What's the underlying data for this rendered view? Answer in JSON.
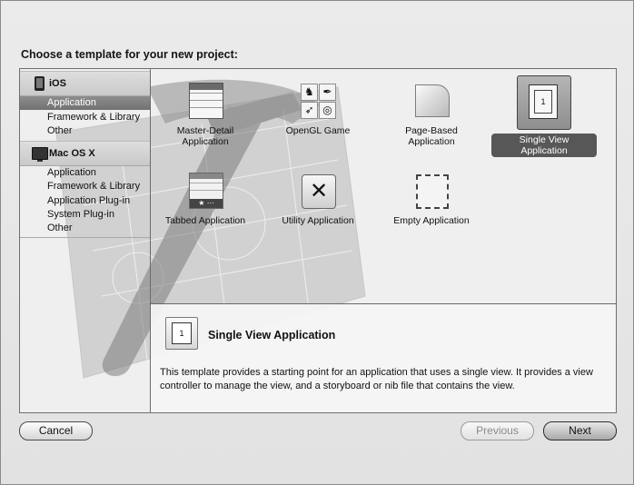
{
  "dialog": {
    "title": "Choose a template for your new project:"
  },
  "sidebar": {
    "groups": [
      {
        "header": "iOS",
        "icon": "iphone-icon",
        "items": [
          "Application",
          "Framework & Library",
          "Other"
        ],
        "selected": "Application"
      },
      {
        "header": "Mac OS X",
        "icon": "mac-icon",
        "items": [
          "Application",
          "Framework & Library",
          "Application Plug-in",
          "System Plug-in",
          "Other"
        ]
      }
    ]
  },
  "templates": [
    {
      "label": "Master-Detail Application",
      "icon": "master-detail-icon"
    },
    {
      "label": "OpenGL Game",
      "icon": "opengl-game-icon"
    },
    {
      "label": "Page-Based Application",
      "icon": "page-curl-icon"
    },
    {
      "label": "Single View Application",
      "icon": "single-view-icon",
      "selected": true
    },
    {
      "label": "Tabbed Application",
      "icon": "tabbed-icon"
    },
    {
      "label": "Utility Application",
      "icon": "tools-icon"
    },
    {
      "label": "Empty Application",
      "icon": "empty-icon"
    }
  ],
  "detail": {
    "title": "Single View Application",
    "icon_number": "1",
    "description": "This template provides a starting point for an application that uses a single view. It provides a view controller to manage the view, and a storyboard or nib file that contains the view."
  },
  "buttons": {
    "cancel": "Cancel",
    "previous": "Previous",
    "next": "Next"
  }
}
